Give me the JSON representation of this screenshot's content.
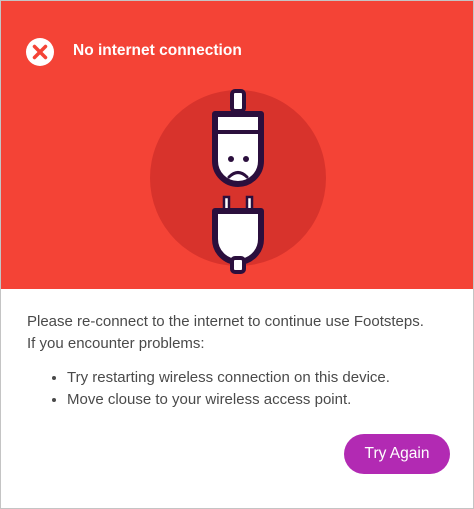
{
  "dialog": {
    "title": "No internet connection",
    "close_icon": "close-icon",
    "illustration_icon": "unplugged-cable-sad-icon"
  },
  "content": {
    "message_line1": "Please re-connect to the internet to continue use Footsteps.",
    "message_line2": "If you encounter problems:",
    "tips": [
      "Try restarting wireless connection on this device.",
      "Move clouse to your wireless access point."
    ]
  },
  "actions": {
    "try_again_label": "Try Again"
  },
  "colors": {
    "header_bg": "#f44336",
    "circle_bg": "#d8332c",
    "icon_outline": "#2b0f3d",
    "button_bg": "#b22ab3",
    "text": "#4a4a4a"
  }
}
